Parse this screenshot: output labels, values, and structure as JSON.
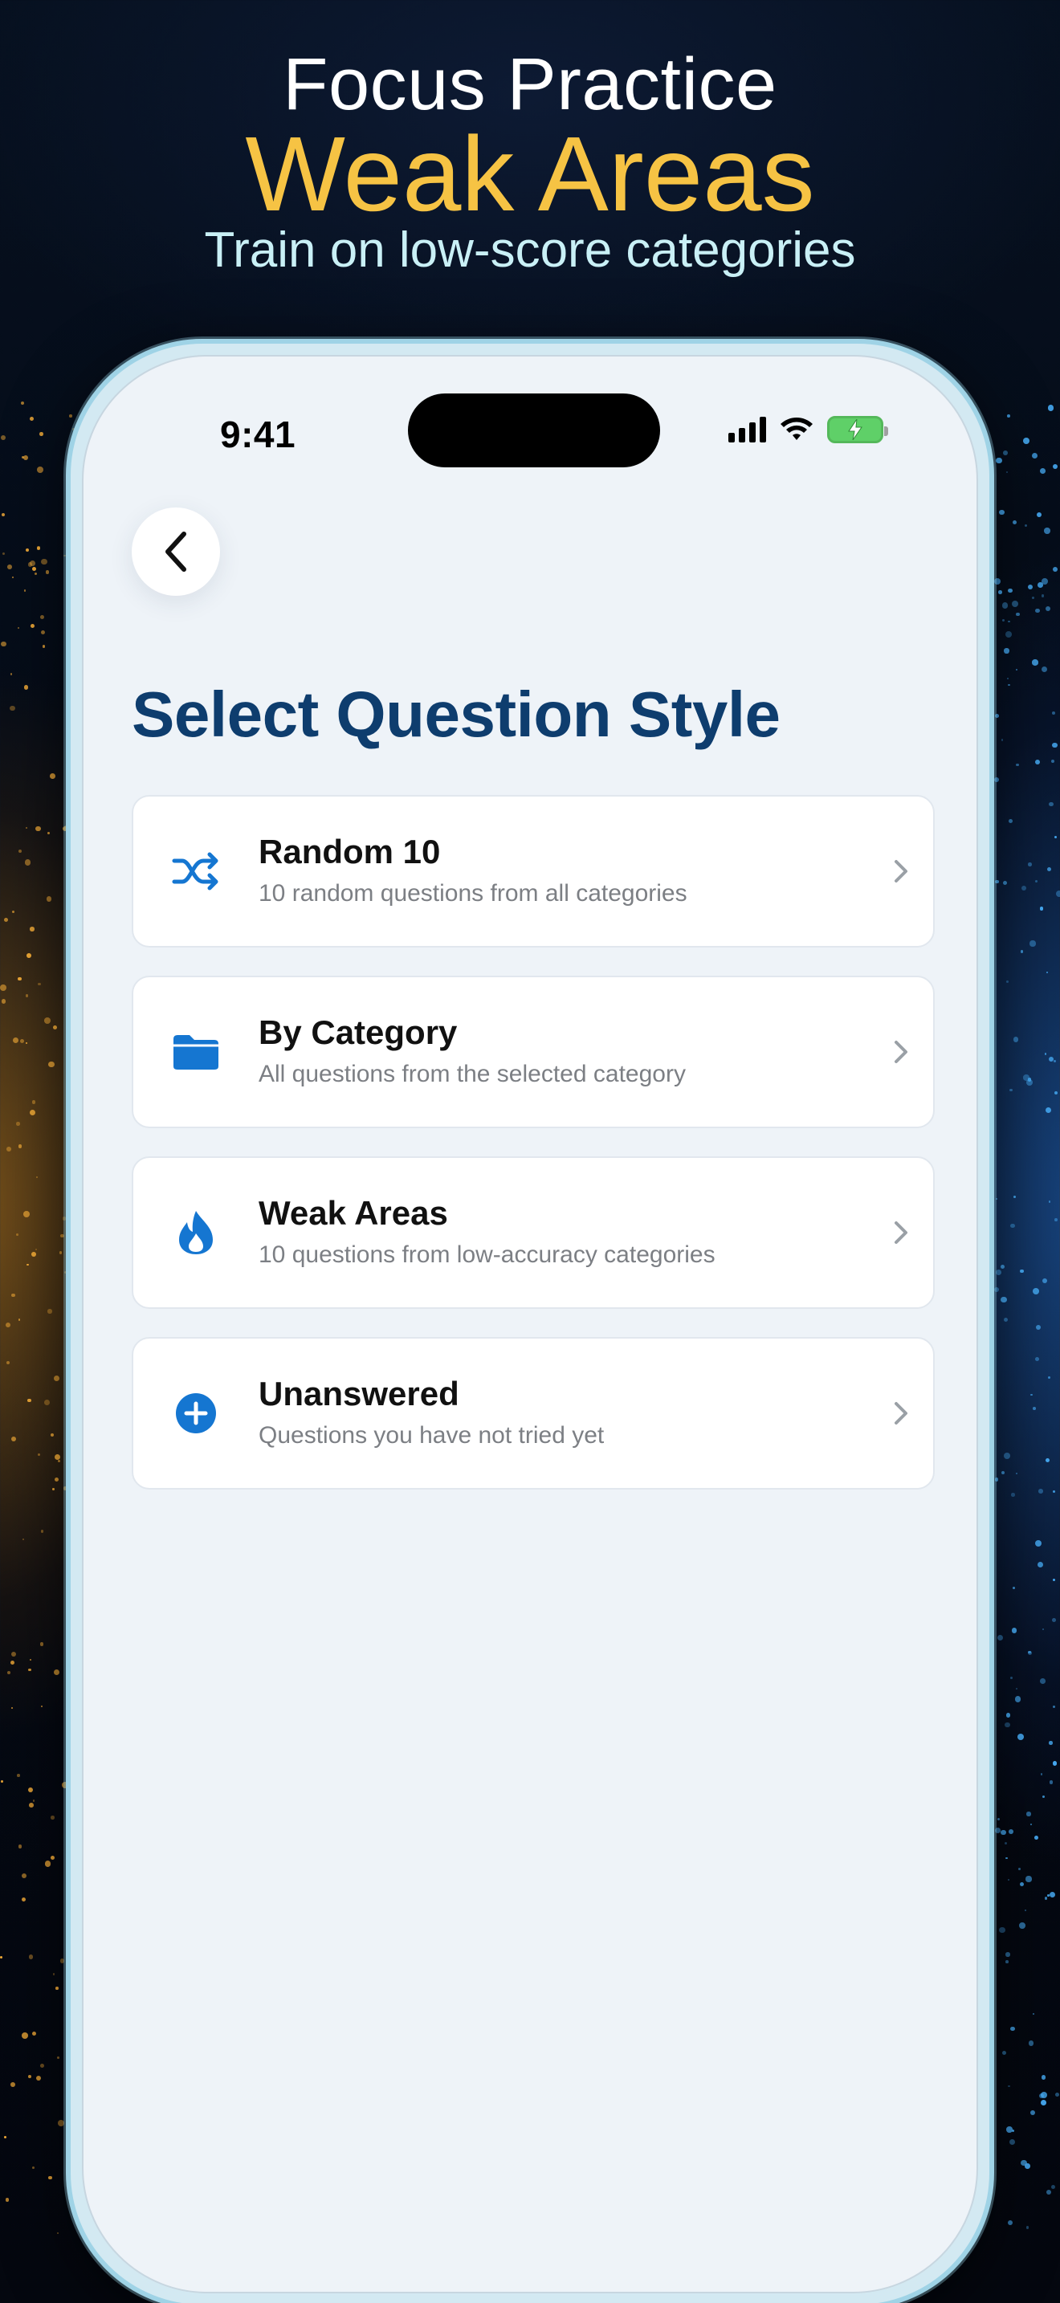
{
  "hero": {
    "line1": "Focus Practice",
    "line2": "Weak Areas",
    "line3": "Train on low-score categories"
  },
  "status_bar": {
    "time": "9:41"
  },
  "page": {
    "title": "Select Question Style"
  },
  "options": [
    {
      "title": "Random 10",
      "subtitle": "10 random questions from all categories",
      "icon": "shuffle-icon"
    },
    {
      "title": "By Category",
      "subtitle": "All questions from the selected category",
      "icon": "folder-icon"
    },
    {
      "title": "Weak Areas",
      "subtitle": "10 questions from low-accuracy categories",
      "icon": "flame-icon"
    },
    {
      "title": "Unanswered",
      "subtitle": "Questions you have not tried yet",
      "icon": "plus-circle-icon"
    }
  ],
  "colors": {
    "accent_blue": "#1576d1",
    "title_navy": "#0e3d6e",
    "hero_gold": "#f6c344",
    "battery_green": "#5fd068"
  }
}
